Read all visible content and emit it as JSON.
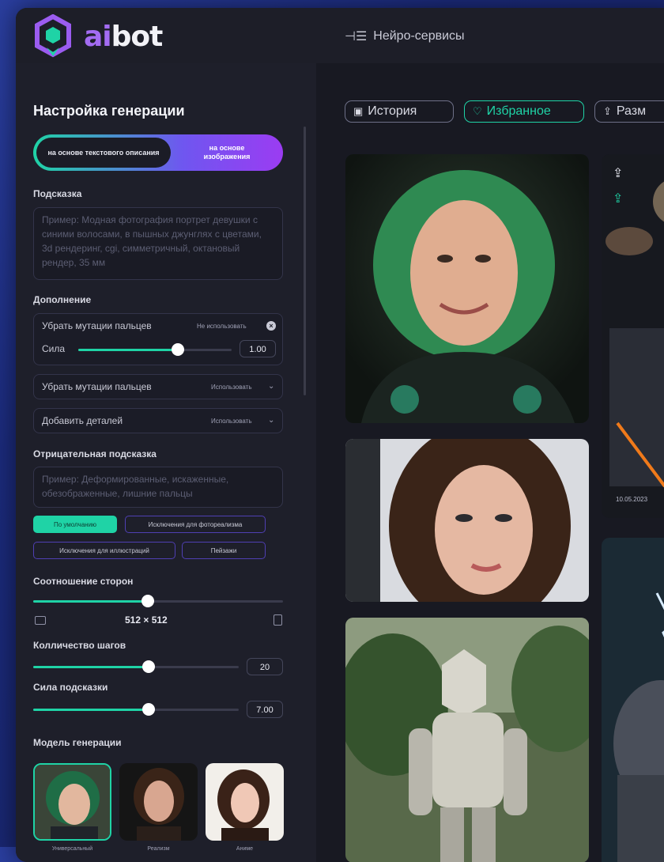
{
  "app": {
    "logo": {
      "ai": "ai",
      "bot": "bot"
    },
    "nav_link": "Нейро-сервисы"
  },
  "sidebar": {
    "title": "Настройка генерации",
    "mode_toggle": {
      "option_text": "на основе текстового описания",
      "option_image": "на основе изображения",
      "selected": "на основе текстового описания"
    },
    "prompt": {
      "label": "Подсказка",
      "placeholder": "Пример: Модная фотография портрет девушки с синими волосами, в пышных джунглях с цветами, 3d рендеринг, cgi, симметричный, октановый рендер, 35 мм"
    },
    "addons": {
      "label": "Дополнение",
      "item1": {
        "name": "Убрать мутации пальцев",
        "status": "Не использовать",
        "strength_label": "Сила",
        "strength_value": "1.00",
        "strength_fraction": 0.65
      },
      "item2": {
        "name": "Убрать мутации пальцев",
        "status": "Использовать"
      },
      "item3": {
        "name": "Добавить деталей",
        "status": "Использовать"
      }
    },
    "negative": {
      "label": "Отрицательная подсказка",
      "placeholder": "Пример: Деформированные, искаженные, обезображенные, лишние пальцы",
      "presets": [
        "По умолчанию",
        "Исключения для фотореализма",
        "Исключения для иллюстраций",
        "Пейзажи"
      ],
      "active_preset": "По умолчанию"
    },
    "aspect": {
      "label": "Соотношение сторон",
      "value": "512 × 512",
      "fraction": 0.46
    },
    "steps": {
      "label": "Колличество шагов",
      "value": "20",
      "fraction": 0.56
    },
    "guidance": {
      "label": "Сила подсказки",
      "value": "7.00",
      "fraction": 0.56
    },
    "models": {
      "label": "Модель генерации",
      "items": [
        "Универсальный",
        "Реализм",
        "Аниме"
      ]
    }
  },
  "main": {
    "tabs": [
      "История",
      "Избранное",
      "Разм"
    ],
    "active_tab": "Избранное",
    "date": "10.05.2023"
  },
  "colors": {
    "accent": "#1fd3a6",
    "purple": "#9b3cf2",
    "bg": "#1a1b24"
  }
}
